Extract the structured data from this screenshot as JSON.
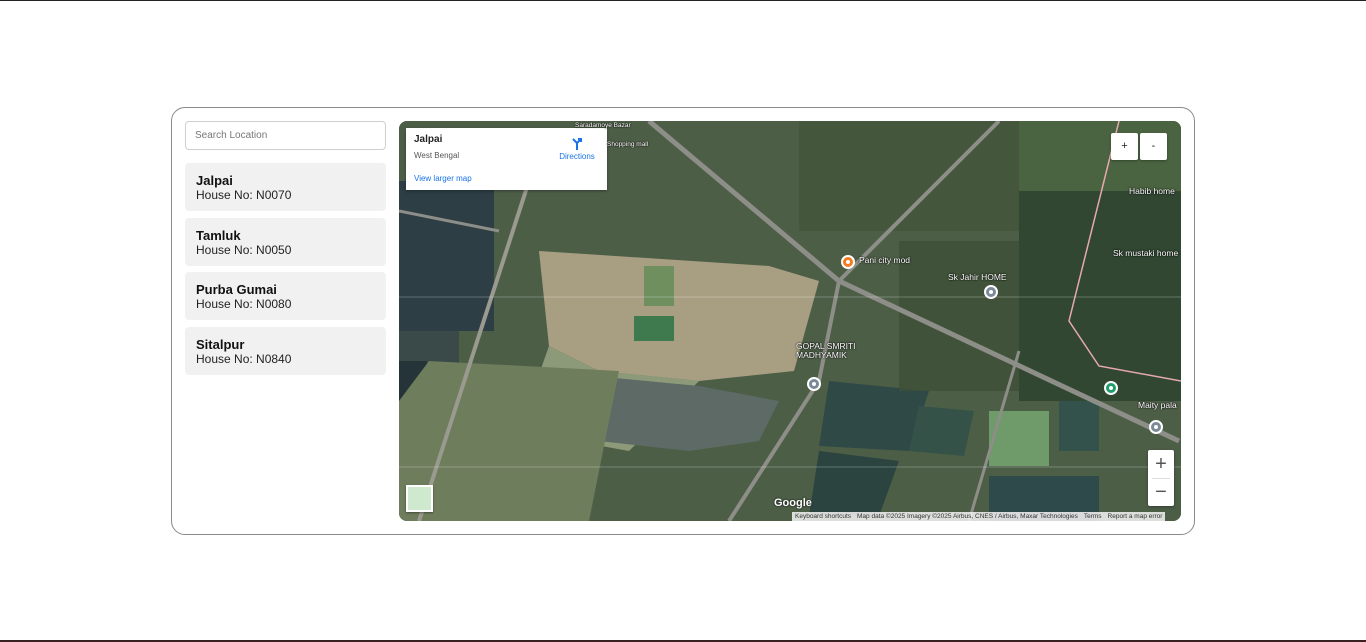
{
  "search": {
    "placeholder": "Search Location"
  },
  "locations": [
    {
      "name": "Jalpai",
      "house": "House No: N0070"
    },
    {
      "name": "Tamluk",
      "house": "House No: N0050"
    },
    {
      "name": "Purba Gumai",
      "house": "House No: N0080"
    },
    {
      "name": "Sitalpur",
      "house": "House No: N0840"
    }
  ],
  "map": {
    "info": {
      "title": "Jalpai",
      "subtitle": "West Bengal",
      "directions": "Directions",
      "larger_map": "View larger map"
    },
    "zoom_in": "+",
    "zoom_out": "-",
    "google_zoom_in": "+",
    "google_zoom_out": "−",
    "logo": "Google",
    "attribution": {
      "shortcuts": "Keyboard shortcuts",
      "data": "Map data ©2025 Imagery ©2025 Airbus, CNES / Airbus, Maxar Technologies",
      "terms": "Terms",
      "report": "Report a map error"
    },
    "places": {
      "shopping": "Shopping mall",
      "bazar": "Saradamoye Bazar",
      "pani": "Pani city mod",
      "jahir": "Sk Jahir HOME",
      "gopal1": "GOPAL SMRITI",
      "gopal2": "MADHYAMIK",
      "habib": "Habib home",
      "mustaki": "Sk mustaki home",
      "maity": "Maity pala"
    },
    "colors": {
      "info_link": "#1a73e8",
      "pin_orange": "#f47b20",
      "pin_gray": "#7a8a99",
      "pin_green": "#1e9e6a"
    }
  }
}
